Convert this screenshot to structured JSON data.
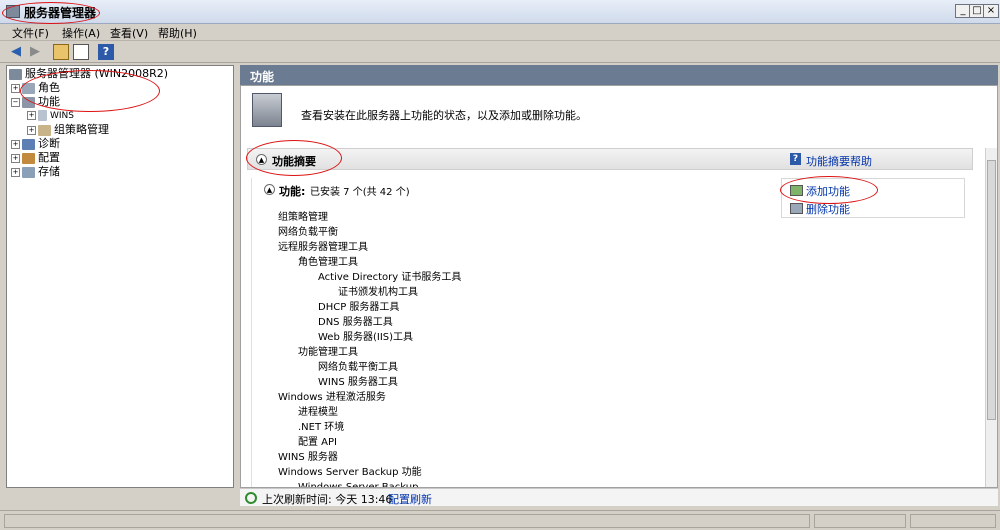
{
  "window": {
    "title": "服务器管理器",
    "min": "_",
    "max": "□",
    "close": "×"
  },
  "menu": [
    "文件(F)",
    "操作(A)",
    "查看(V)",
    "帮助(H)"
  ],
  "tree": {
    "root": "服务器管理器 (WIN2008R2)",
    "items": [
      {
        "label": "角色",
        "expander": "+"
      },
      {
        "label": "功能",
        "expander": "−"
      },
      {
        "label": "WINS",
        "expander": "+"
      },
      {
        "label": "组策略管理",
        "expander": "+"
      },
      {
        "label": "诊断",
        "expander": "+"
      },
      {
        "label": "配置",
        "expander": "+"
      },
      {
        "label": "存储",
        "expander": "+"
      }
    ]
  },
  "content": {
    "header": "功能",
    "intro": "查看安装在此服务器上功能的状态，以及添加或删除功能。",
    "section_title": "功能摘要",
    "section_help": "功能摘要帮助",
    "features_label": "功能:",
    "features_count": "已安装 7 个(共 42 个)",
    "actions": {
      "add": "添加功能",
      "remove": "删除功能"
    },
    "features": [
      "组策略管理",
      "网络负载平衡",
      "远程服务器管理工具",
      "角色管理工具",
      "Active Directory 证书服务工具",
      "证书颁发机构工具",
      "DHCP 服务器工具",
      "DNS 服务器工具",
      "Web 服务器(IIS)工具",
      "功能管理工具",
      "网络负载平衡工具",
      "WINS 服务器工具",
      "Windows 进程激活服务",
      "进程模型",
      ".NET 环境",
      "配置 API",
      "WINS 服务器",
      "Windows Server Backup 功能",
      "Windows Server Backup"
    ]
  },
  "refresh": {
    "label": "上次刷新时间: 今天 13:46",
    "link": "配置刷新"
  },
  "colors": {
    "header_bg": "#6b7b92",
    "link": "#0033aa",
    "annotation": "#dd1111"
  }
}
